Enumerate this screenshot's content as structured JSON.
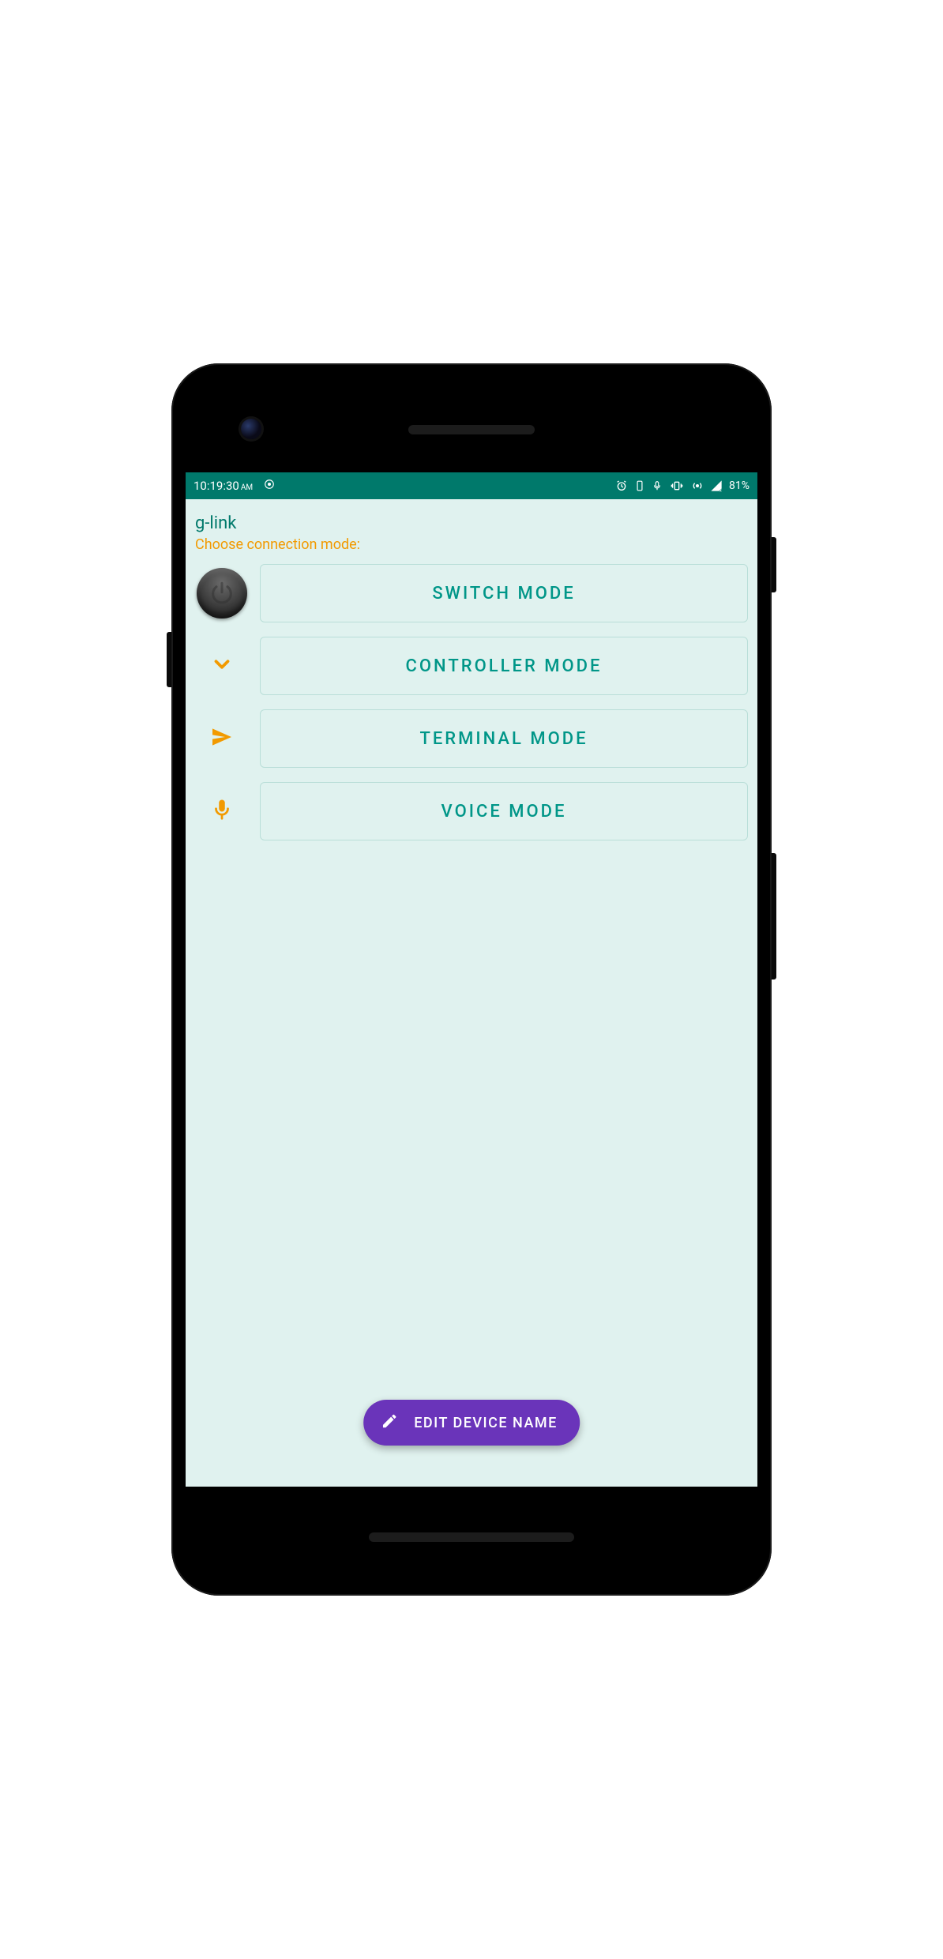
{
  "status": {
    "time": "10:19:30",
    "ampm": "AM",
    "battery": "81%"
  },
  "app": {
    "title": "g-link",
    "subtitle": "Choose connection mode:"
  },
  "modes": {
    "switch": "SWITCH MODE",
    "controller": "CONTROLLER MODE",
    "terminal": "TERMINAL MODE",
    "voice": "VOICE MODE"
  },
  "fab": {
    "label": "EDIT DEVICE NAME"
  }
}
